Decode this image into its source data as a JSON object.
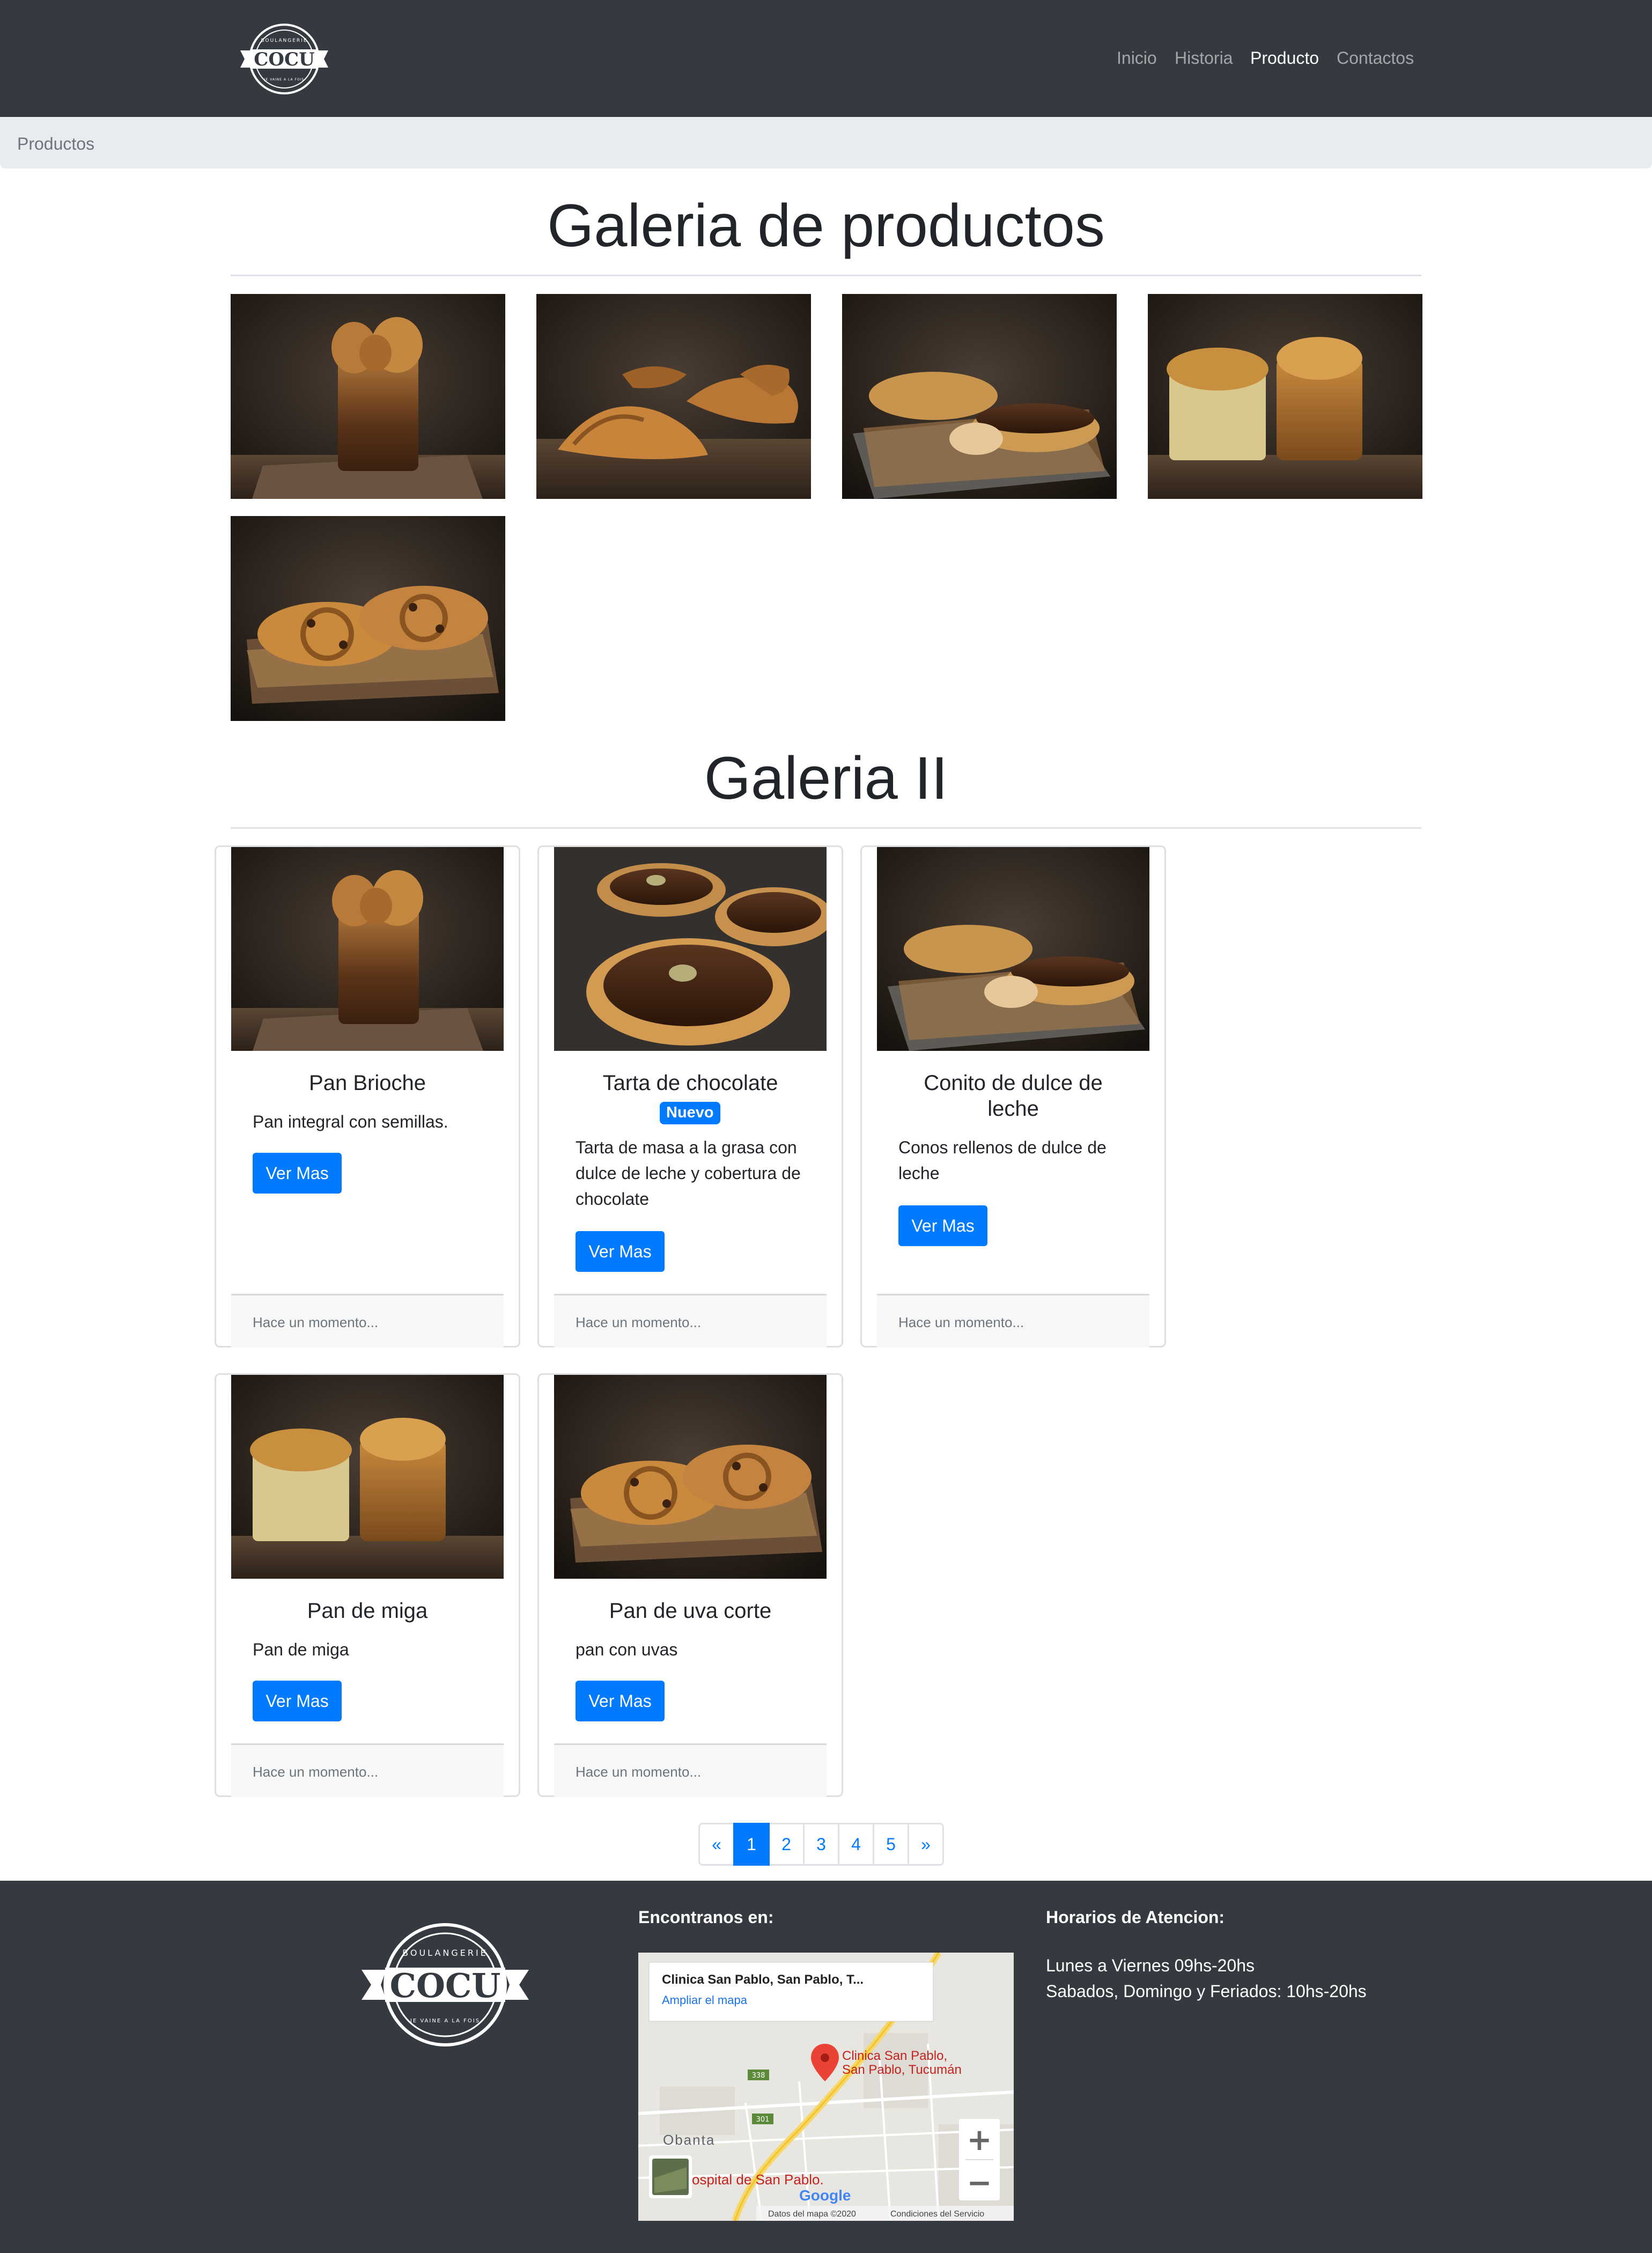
{
  "brand": {
    "logo_top_text": "BOULANGERIE",
    "logo_name": "COCU",
    "logo_tagline": "JE VAINE A LA FOIS"
  },
  "nav": {
    "items": [
      {
        "label": "Inicio"
      },
      {
        "label": "Historia"
      },
      {
        "label": "Producto"
      },
      {
        "label": "Contactos"
      }
    ],
    "active": "Producto"
  },
  "breadcrumb": {
    "current": "Productos"
  },
  "gallery1": {
    "title": "Galeria de productos",
    "images": [
      "brioche-loaf",
      "croissants",
      "eclairs",
      "bread-loaves",
      "raisin-swirl"
    ]
  },
  "gallery2": {
    "title": "Galeria II",
    "cards": [
      {
        "title": "Pan Brioche",
        "badge": "",
        "text": "Pan integral con semillas.",
        "button": "Ver Mas",
        "footer": "Hace un momento..."
      },
      {
        "title": "Tarta de chocolate",
        "badge": "Nuevo",
        "text_lines": [
          "Tarta de masa a la grasa con",
          "dulce de leche y cobertura de",
          "chocolate"
        ],
        "button": "Ver Mas",
        "footer": "Hace un momento..."
      },
      {
        "title_lines": [
          "Conito de dulce de",
          "leche"
        ],
        "badge": "",
        "text_lines": [
          "Conos rellenos de dulce de",
          "leche"
        ],
        "button": "Ver Mas",
        "footer": "Hace un momento..."
      },
      {
        "title": "Pan de miga",
        "badge": "",
        "text": "Pan de miga",
        "button": "Ver Mas",
        "footer": "Hace un momento..."
      },
      {
        "title": "Pan de uva corte",
        "badge": "",
        "text": "pan con uvas",
        "button": "Ver Mas",
        "footer": "Hace un momento..."
      }
    ]
  },
  "pagination": {
    "prev": "«",
    "pages": [
      "1",
      "2",
      "3",
      "4",
      "5"
    ],
    "next": "»",
    "active": "1"
  },
  "footer": {
    "find_us": "Encontranos en:",
    "hours_title": "Horarios de Atencion:",
    "hours": [
      "Lunes a Viernes 09hs-20hs",
      "Sabados, Domingo y Feriados: 10hs-20hs"
    ],
    "map": {
      "place_title": "Clinica San Pablo, San Pablo, T...",
      "enlarge_link": "Ampliar el mapa",
      "pin_label_lines": [
        "Clinica San Pablo,",
        "San Pablo, Tucumán"
      ],
      "town": "Obanta",
      "hospital": "ospital de San Pablo.",
      "road_1": "338",
      "road_2": "301",
      "google": "Google",
      "map_data": "Datos del mapa ©2020",
      "terms": "Condiciones del Servicio",
      "zoom_in": "+",
      "zoom_out": "−"
    }
  },
  "colors": {
    "navbar": "#343a40",
    "primary": "#007bff",
    "breadcrumb_bg": "#e9ecef",
    "card_footer_bg": "#f7f7f7"
  }
}
